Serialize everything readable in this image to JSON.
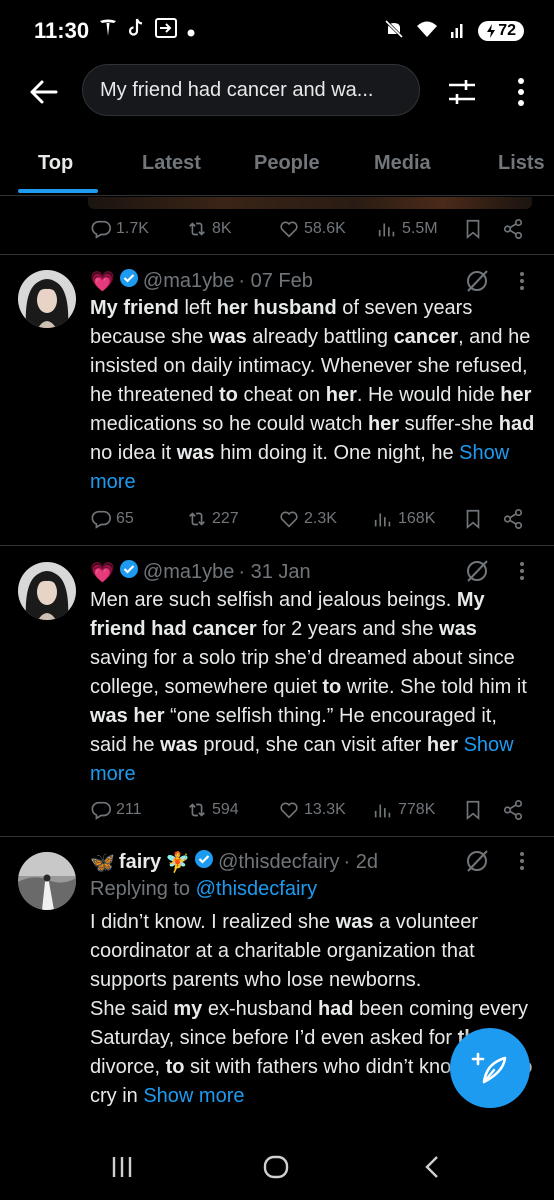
{
  "status_bar": {
    "time": "11:30",
    "battery": "72",
    "icons": [
      "tesla-icon",
      "tiktok-icon",
      "cast-icon",
      "dot-icon",
      "mute-icon",
      "wifi-icon",
      "signal-icon",
      "battery-icon"
    ]
  },
  "search": {
    "query": "My friend had cancer and wa..."
  },
  "tabs": [
    {
      "label": "Top",
      "active": true
    },
    {
      "label": "Latest",
      "active": false
    },
    {
      "label": "People",
      "active": false
    },
    {
      "label": "Media",
      "active": false
    },
    {
      "label": "Lists",
      "active": false
    }
  ],
  "top_actions": {
    "replies": "1.7K",
    "reposts": "8K",
    "likes": "58.6K",
    "views": "5.5M"
  },
  "tweets": [
    {
      "emoji": "💗",
      "handle": "@ma1ybe",
      "date": "· 07 Feb",
      "text_segments": [
        {
          "t": "My friend",
          "b": true
        },
        {
          "t": " left ",
          "b": false
        },
        {
          "t": "her husband",
          "b": true
        },
        {
          "t": " of seven years because she ",
          "b": false
        },
        {
          "t": "was",
          "b": true
        },
        {
          "t": " already battling ",
          "b": false
        },
        {
          "t": "cancer",
          "b": true
        },
        {
          "t": ", and he insisted on daily intimacy. Whenever she refused, he threatened ",
          "b": false
        },
        {
          "t": "to",
          "b": true
        },
        {
          "t": " cheat on ",
          "b": false
        },
        {
          "t": "her",
          "b": true
        },
        {
          "t": ". He would hide ",
          "b": false
        },
        {
          "t": "her",
          "b": true
        },
        {
          "t": " medications so he could watch ",
          "b": false
        },
        {
          "t": "her",
          "b": true
        },
        {
          "t": " suffer-she ",
          "b": false
        },
        {
          "t": "had",
          "b": true
        },
        {
          "t": " no idea it ",
          "b": false
        },
        {
          "t": "was",
          "b": true
        },
        {
          "t": " him doing it. One night, he ",
          "b": false
        }
      ],
      "show_more": "Show more",
      "replies": "65",
      "reposts": "227",
      "likes": "2.3K",
      "views": "168K"
    },
    {
      "emoji": "💗",
      "handle": "@ma1ybe",
      "date": "· 31 Jan",
      "text_segments": [
        {
          "t": "Men are such selfish and jealous beings. ",
          "b": false
        },
        {
          "t": "My friend had cancer",
          "b": true
        },
        {
          "t": " for 2 years and she ",
          "b": false
        },
        {
          "t": "was",
          "b": true
        },
        {
          "t": " saving for a solo trip she’d dreamed about since college, somewhere quiet ",
          "b": false
        },
        {
          "t": "to",
          "b": true
        },
        {
          "t": " write. She told him it ",
          "b": false
        },
        {
          "t": "was her",
          "b": true
        },
        {
          "t": " “one selfish thing.” He encouraged it, said he ",
          "b": false
        },
        {
          "t": "was",
          "b": true
        },
        {
          "t": " proud, she can visit after ",
          "b": false
        },
        {
          "t": "her",
          "b": true
        },
        {
          "t": " ",
          "b": false
        }
      ],
      "show_more": "Show more",
      "replies": "211",
      "reposts": "594",
      "likes": "13.3K",
      "views": "778K"
    },
    {
      "name_prefix": "🦋",
      "name": "fairy",
      "name_suffix": "🧚",
      "handle": "@thisdecfairy",
      "date": "· 2d",
      "replying_label": "Replying to",
      "replying_to": "@thisdecfairy",
      "text_segments": [
        {
          "t": "I didn’t know. I realized she ",
          "b": false
        },
        {
          "t": "was",
          "b": true
        },
        {
          "t": " a volunteer coordinator at a charitable organization that supports parents who lose newborns.",
          "b": false
        },
        {
          "t": "\nShe said ",
          "b": false
        },
        {
          "t": "my",
          "b": true
        },
        {
          "t": " ex-husband ",
          "b": false
        },
        {
          "t": "had",
          "b": true
        },
        {
          "t": " been coming every Saturday, since before I’d even asked for ",
          "b": false
        },
        {
          "t": "the",
          "b": true
        },
        {
          "t": " divorce, ",
          "b": false
        },
        {
          "t": "to",
          "b": true
        },
        {
          "t": " sit with fathers who didn’t know how ",
          "b": false
        },
        {
          "t": "to",
          "b": true
        },
        {
          "t": " cry in ",
          "b": false
        }
      ],
      "show_more": "Show more"
    }
  ],
  "colors": {
    "accent": "#1d9bf0",
    "muted": "#71767b",
    "text": "#e7e9ea",
    "divider": "#2f3336",
    "background": "#000000"
  }
}
